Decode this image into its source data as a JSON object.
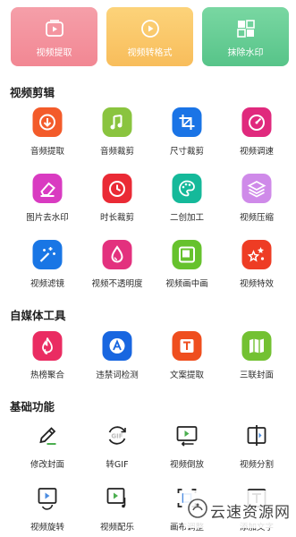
{
  "top_cards": [
    {
      "label": "视频提取",
      "icon": "video-extract-icon"
    },
    {
      "label": "视频转格式",
      "icon": "video-convert-icon"
    },
    {
      "label": "抹除水印",
      "icon": "erase-watermark-icon"
    }
  ],
  "sections": {
    "video_edit": {
      "title": "视频剪辑",
      "items": [
        {
          "label": "音频提取",
          "icon": "audio-extract-icon"
        },
        {
          "label": "音频裁剪",
          "icon": "audio-trim-icon"
        },
        {
          "label": "尺寸裁剪",
          "icon": "crop-icon"
        },
        {
          "label": "视频调速",
          "icon": "speed-icon"
        },
        {
          "label": "图片去水印",
          "icon": "image-eraser-icon"
        },
        {
          "label": "时长裁剪",
          "icon": "duration-clock-icon"
        },
        {
          "label": "二创加工",
          "icon": "palette-icon"
        },
        {
          "label": "视频压缩",
          "icon": "layers-icon"
        },
        {
          "label": "视频滤镜",
          "icon": "filter-sparkle-icon"
        },
        {
          "label": "视频不透明度",
          "icon": "opacity-drop-icon"
        },
        {
          "label": "视频画中画",
          "icon": "pip-icon"
        },
        {
          "label": "视频特效",
          "icon": "effects-stars-icon"
        }
      ]
    },
    "media_tools": {
      "title": "自媒体工具",
      "items": [
        {
          "label": "热榜聚合",
          "icon": "hot-flame-icon"
        },
        {
          "label": "违禁词检测",
          "icon": "word-check-icon"
        },
        {
          "label": "文案提取",
          "icon": "text-extract-icon"
        },
        {
          "label": "三联封面",
          "icon": "triple-cover-icon"
        }
      ]
    },
    "basic": {
      "title": "基础功能",
      "items": [
        {
          "label": "修改封面",
          "icon": "edit-cover-icon"
        },
        {
          "label": "转GIF",
          "icon": "gif-icon"
        },
        {
          "label": "视频倒放",
          "icon": "reverse-play-icon"
        },
        {
          "label": "视频分割",
          "icon": "split-icon"
        },
        {
          "label": "视频旋转",
          "icon": "rotate-icon"
        },
        {
          "label": "视频配乐",
          "icon": "music-icon"
        },
        {
          "label": "画布调整",
          "icon": "canvas-icon"
        },
        {
          "label": "添加文字",
          "icon": "add-text-icon"
        }
      ]
    }
  },
  "watermark": {
    "text": "云速资源网"
  }
}
